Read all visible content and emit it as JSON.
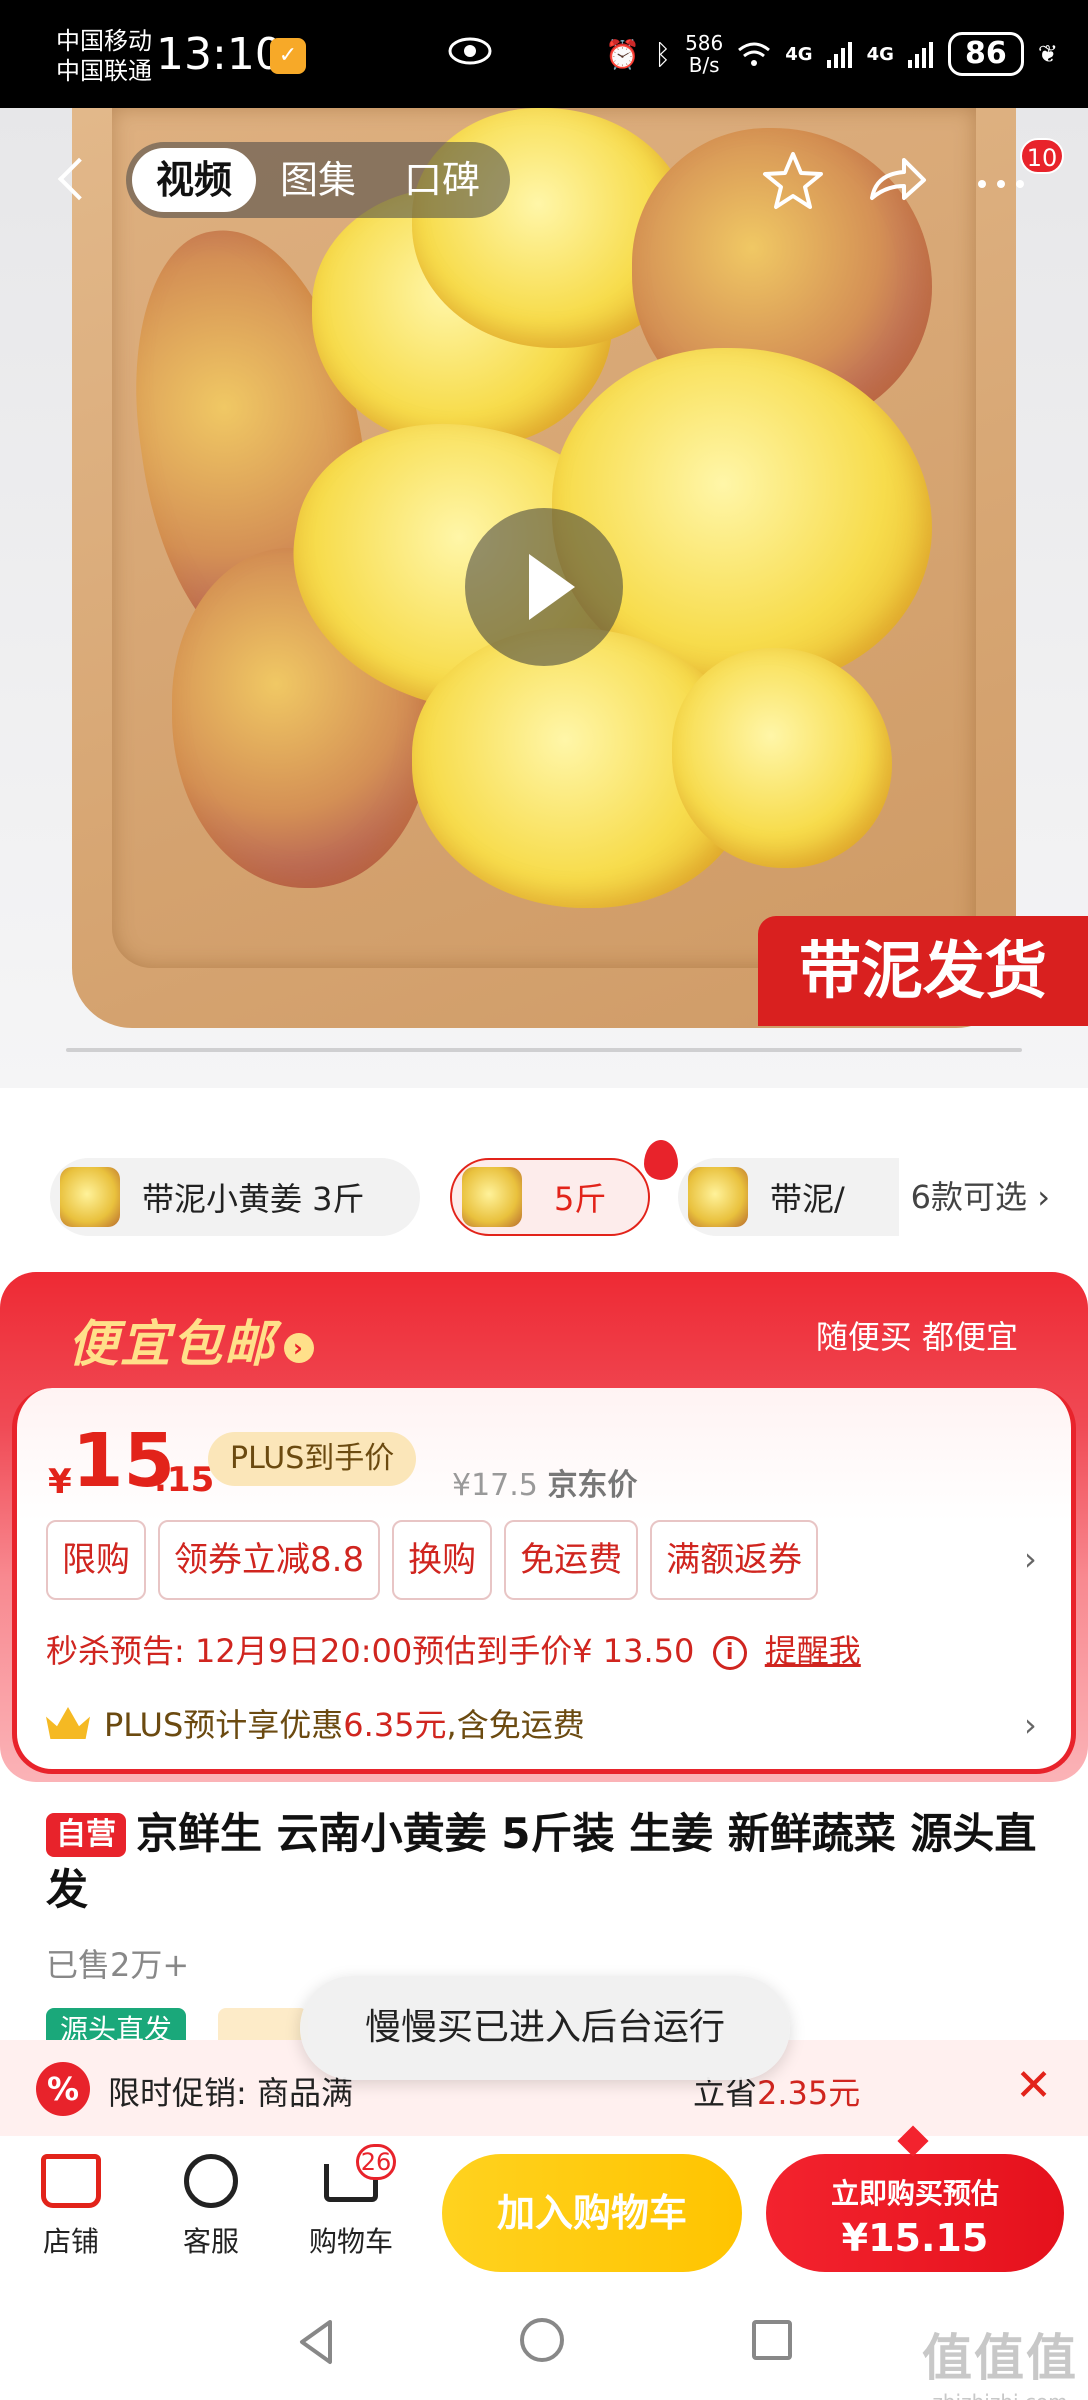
{
  "status_bar": {
    "carrier_1": "中国移动",
    "carrier_2": "中国联通",
    "time": "13:10",
    "net_speed_value": "586",
    "net_speed_unit": "B/s",
    "signal_1": "4G",
    "signal_2": "4G",
    "battery": "86",
    "icons": [
      "eye-icon",
      "alarm-icon",
      "bluetooth-icon",
      "wifi-icon",
      "signal-icon",
      "leaf-icon"
    ]
  },
  "hero": {
    "media_tabs": [
      "视频",
      "图集",
      "口碑"
    ],
    "active_tab": 0,
    "mud_tag": "带泥发货",
    "more_badge": "10"
  },
  "variants": {
    "items": [
      "带泥小黄姜 3斤",
      "5斤",
      "带泥/"
    ],
    "selected_index": 1,
    "more": "6款可选 ›"
  },
  "promo": {
    "title": "便宜包邮",
    "title_arrow": "›",
    "slogan": "随便买 都便宜"
  },
  "price": {
    "currency": "¥",
    "integer": "15",
    "decimal": ".15",
    "plus_tag": "PLUS到手价",
    "jd_price": "¥17.5",
    "jd_label": "京东价"
  },
  "chips": [
    "限购",
    "领券立减8.8",
    "换购",
    "免运费",
    "满额返券"
  ],
  "chips_arrow": "›",
  "flash_sale": {
    "prefix": "秒杀预告:",
    "text": "12月9日20:00预估到手价¥ 13.50",
    "info_icon": "i",
    "remind": "提醒我"
  },
  "plus_row": {
    "prefix": "PLUS预计享优惠",
    "amount": "6.35元",
    "suffix": ",含免运费",
    "arrow": "›"
  },
  "product": {
    "badge": "自营",
    "title": "京鲜生 云南小黄姜 5斤装 生姜 新鲜蔬菜 源头直发",
    "sold": "已售2万+",
    "tag_source": "源头直发"
  },
  "limit_promo": {
    "icon": "%",
    "text": "限时促销: 商品满",
    "save_prefix": "立省",
    "save_amount": "2.35元",
    "close": "✕"
  },
  "toast": "慢慢买已进入后台运行",
  "bottom_bar": {
    "shop": "店铺",
    "service": "客服",
    "cart": "购物车",
    "cart_count": "26",
    "add_to_cart": "加入购物车",
    "buy_now_label": "立即购买预估",
    "buy_now_price": "¥15.15"
  },
  "watermark": {
    "main": "值值值",
    "sub": "zhizhizhi.com"
  },
  "colors": {
    "accent_red": "#e8232b",
    "promo_gold": "#ffe08a",
    "cart_yellow": "#ffc400"
  }
}
